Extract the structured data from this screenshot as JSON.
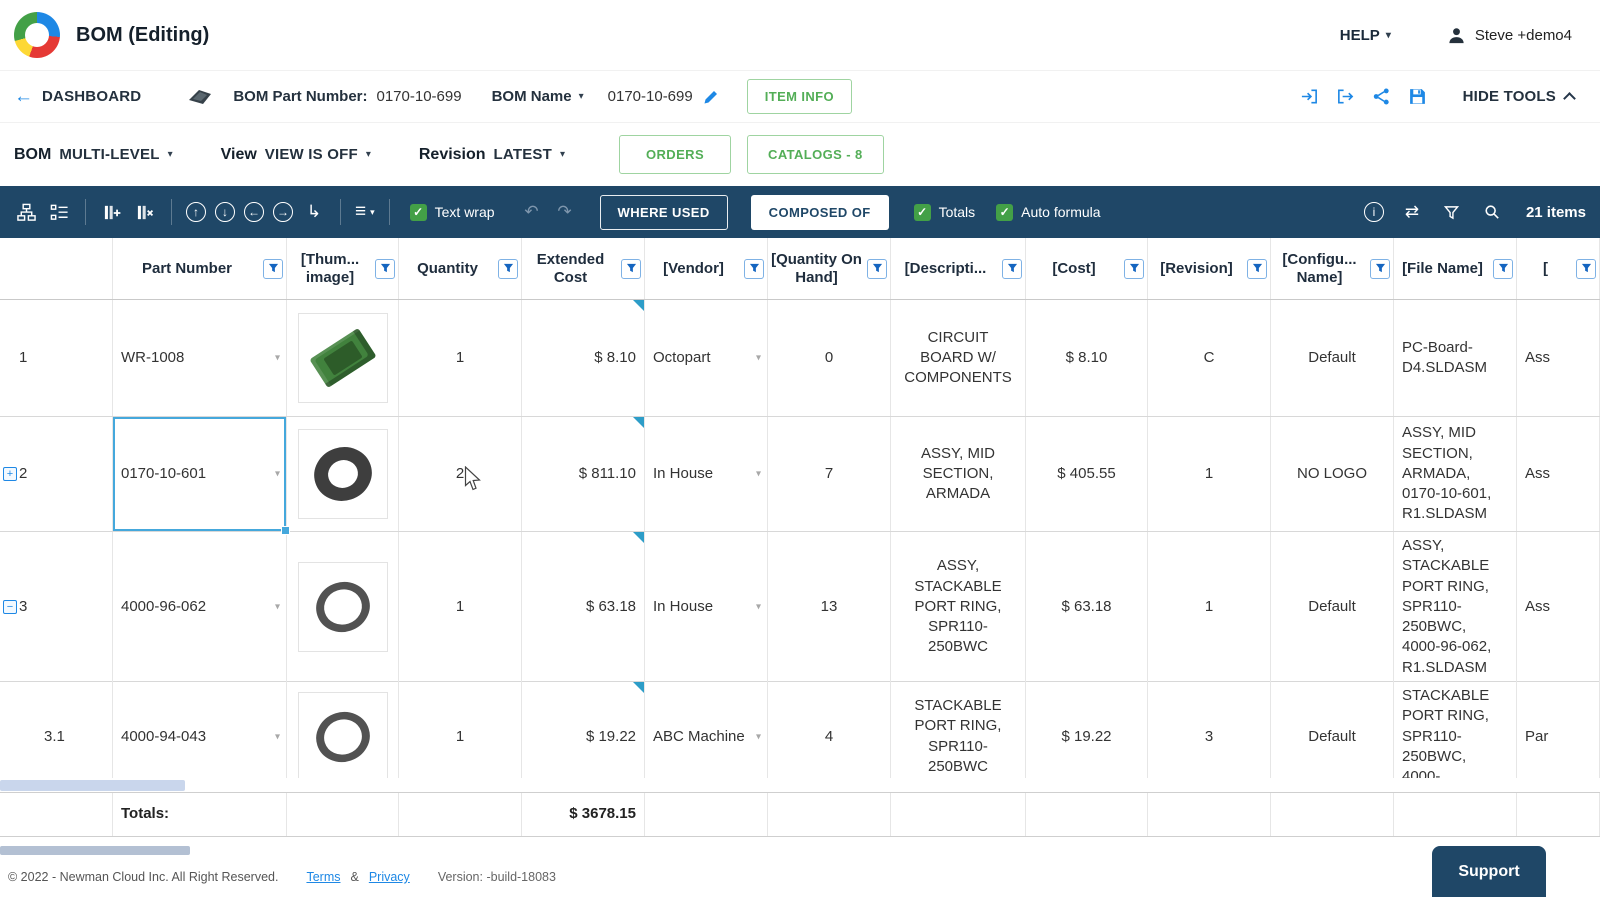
{
  "header": {
    "title": "BOM (Editing)",
    "help": "HELP",
    "user": "Steve +demo4"
  },
  "infobar": {
    "back": "DASHBOARD",
    "part_number_label": "BOM Part Number:",
    "part_number": "0170-10-699",
    "bom_name_label": "BOM Name",
    "bom_name": "0170-10-699",
    "item_info": "ITEM INFO",
    "hide_tools": "HIDE TOOLS"
  },
  "controls": {
    "bom_label": "BOM",
    "bom_mode": "MULTI-LEVEL",
    "view_label": "View",
    "view_mode": "VIEW IS OFF",
    "revision_label": "Revision",
    "revision_mode": "LATEST",
    "orders": "ORDERS",
    "catalogs": "CATALOGS - 8"
  },
  "toolbar": {
    "text_wrap": "Text wrap",
    "where_used": "WHERE USED",
    "composed_of": "COMPOSED OF",
    "totals": "Totals",
    "auto_formula": "Auto formula",
    "items_count": "21 items"
  },
  "table": {
    "columns": [
      "Part Number",
      "[Thum... image]",
      "Quantity",
      "Extended Cost",
      "[Vendor]",
      "[Quantity On Hand]",
      "[Descripti...",
      "[Cost]",
      "[Revision]",
      "[Configu... Name]",
      "[File Name]",
      "["
    ],
    "rows": [
      {
        "num": "1",
        "part_number": "WR-1008",
        "quantity": "1",
        "extended_cost": "$ 8.10",
        "vendor": "Octopart",
        "on_hand": "0",
        "description": "CIRCUIT BOARD W/ COMPONENTS",
        "cost": "$ 8.10",
        "revision": "C",
        "config_name": "Default",
        "file_name": "PC-Board-D4.SLDASM",
        "type": "Ass"
      },
      {
        "num": "2",
        "part_number": "0170-10-601",
        "quantity": "2",
        "extended_cost": "$ 811.10",
        "vendor": "In House",
        "on_hand": "7",
        "description": "ASSY, MID SECTION, ARMADA",
        "cost": "$ 405.55",
        "revision": "1",
        "config_name": "NO LOGO",
        "file_name": "ASSY, MID SECTION, ARMADA, 0170-10-601, R1.SLDASM",
        "type": "Ass"
      },
      {
        "num": "3",
        "part_number": "4000-96-062",
        "quantity": "1",
        "extended_cost": "$ 63.18",
        "vendor": "In House",
        "on_hand": "13",
        "description": "ASSY, STACKABLE PORT RING, SPR110-250BWC",
        "cost": "$ 63.18",
        "revision": "1",
        "config_name": "Default",
        "file_name": "ASSY, STACKABLE PORT RING, SPR110-250BWC, 4000-96-062, R1.SLDASM",
        "type": "Ass"
      },
      {
        "num": "3.1",
        "part_number": "4000-94-043",
        "quantity": "1",
        "extended_cost": "$ 19.22",
        "vendor": "ABC Machine",
        "on_hand": "4",
        "description": "STACKABLE PORT RING, SPR110-250BWC",
        "cost": "$ 19.22",
        "revision": "3",
        "config_name": "Default",
        "file_name": "STACKABLE PORT RING, SPR110-250BWC, 4000-",
        "type": "Par"
      }
    ],
    "totals_label": "Totals:",
    "totals_extended_cost": "$ 3678.15"
  },
  "footer": {
    "copyright": "© 2022 - Newman Cloud Inc. All Right Reserved.",
    "terms": "Terms",
    "and": "&",
    "privacy": "Privacy",
    "version": "Version: -build-18083",
    "support": "Support"
  },
  "icons": {
    "back": "←",
    "caret": "▾",
    "check": "✓",
    "expand": "+",
    "collapse": "−",
    "undo": "↶",
    "redo": "↷",
    "up": "↑",
    "down": "↓",
    "left": "←",
    "right": "→",
    "indent": "↳",
    "align": "≡",
    "info": "i",
    "swap": "⇄"
  },
  "colors": {
    "navy": "#1f4767",
    "green": "#43a047",
    "blue": "#1e88e5",
    "formula_triangle": "#2d9dc8"
  }
}
